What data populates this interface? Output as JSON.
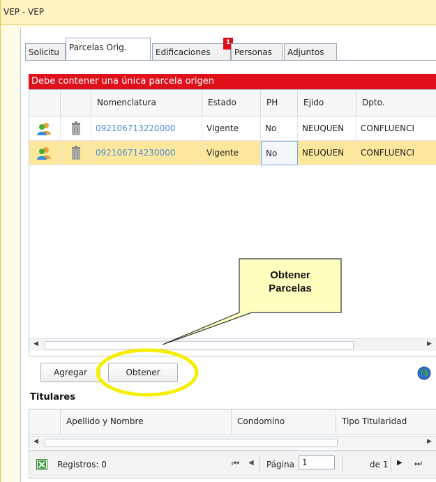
{
  "window": {
    "title": "VEP - VEP"
  },
  "tabs": [
    {
      "label": "Solicitu"
    },
    {
      "label": "Parcelas Orig."
    },
    {
      "label": "Edificaciones"
    },
    {
      "label": "Personas"
    },
    {
      "label": "Adjuntos"
    }
  ],
  "tab_badge": "1",
  "error_message": "Debe contener una única parcela origen",
  "parcelas_grid": {
    "columns": [
      "Nomenclatura",
      "Estado",
      "PH",
      "Ejido",
      "Dpto."
    ],
    "rows": [
      {
        "nomenclatura": "092106713220000",
        "estado": "Vigente",
        "ph": "No",
        "ejido": "NEUQUEN",
        "dpto": "CONFLUENCI"
      },
      {
        "nomenclatura": "092106714230000",
        "estado": "Vigente",
        "ph": "No",
        "ejido": "NEUQUEN",
        "dpto": "CONFLUENCI"
      }
    ],
    "selected_row": 1
  },
  "buttons": {
    "agregar": "Agregar",
    "obtener": "Obtener"
  },
  "callout": {
    "line1": "Obtener",
    "line2": "Parcelas"
  },
  "titulares": {
    "label": "Titulares",
    "columns": [
      "Apellido y Nombre",
      "Condomino",
      "Tipo Titularidad"
    ]
  },
  "pager": {
    "registros": "Registros: 0",
    "pagina_label": "Página",
    "pagina_value": "1",
    "de_label": "de 1"
  },
  "icons": {
    "users": "users-icon",
    "trash": "trash-icon",
    "globe": "globe-icon",
    "excel": "excel-icon"
  },
  "colors": {
    "error": "#e0101a",
    "selected_row": "#fde79d",
    "callout_fill": "#ffffc0",
    "highlight_ring": "#f5ee00",
    "link": "#4a8fd6"
  }
}
